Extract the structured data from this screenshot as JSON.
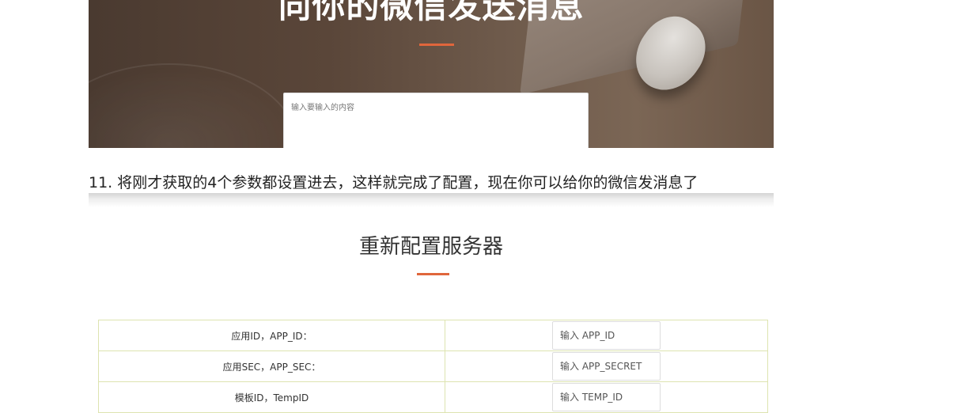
{
  "hero": {
    "title": "向你的微信发送消息",
    "message_placeholder": "输入要输入的内容",
    "accent_color": "#e0663c"
  },
  "step": {
    "text": "11. 将刚才获取的4个参数都设置进去，这样就完成了配置，现在你可以给你的微信发消息了"
  },
  "config": {
    "title": "重新配置服务器",
    "rows": [
      {
        "label": "应用ID，APP_ID：",
        "placeholder": "输入 APP_ID"
      },
      {
        "label": "应用SEC，APP_SEC：",
        "placeholder": "输入 APP_SECRET"
      },
      {
        "label": "模板ID，TempID",
        "placeholder": "输入 TEMP_ID"
      }
    ]
  }
}
